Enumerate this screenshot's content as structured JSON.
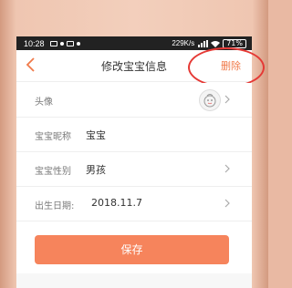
{
  "status_bar": {
    "time": "10:28",
    "speed": "229K/s",
    "battery": "71%"
  },
  "header": {
    "title": "修改宝宝信息",
    "delete_label": "删除"
  },
  "rows": [
    {
      "label": "头像",
      "value": ""
    },
    {
      "label": "宝宝昵称",
      "value": "宝宝"
    },
    {
      "label": "宝宝性别",
      "value": "男孩"
    },
    {
      "label": "出生日期:",
      "value": "2018.11.7"
    }
  ],
  "save_label": "保存",
  "colors": {
    "accent": "#f6845c",
    "delete_text": "#f07a4a",
    "annotation": "#e53935"
  },
  "icons": [
    "back-arrow-icon",
    "chevron-right-icon",
    "avatar-icon",
    "wifi-icon",
    "signal-icon",
    "battery-icon"
  ]
}
